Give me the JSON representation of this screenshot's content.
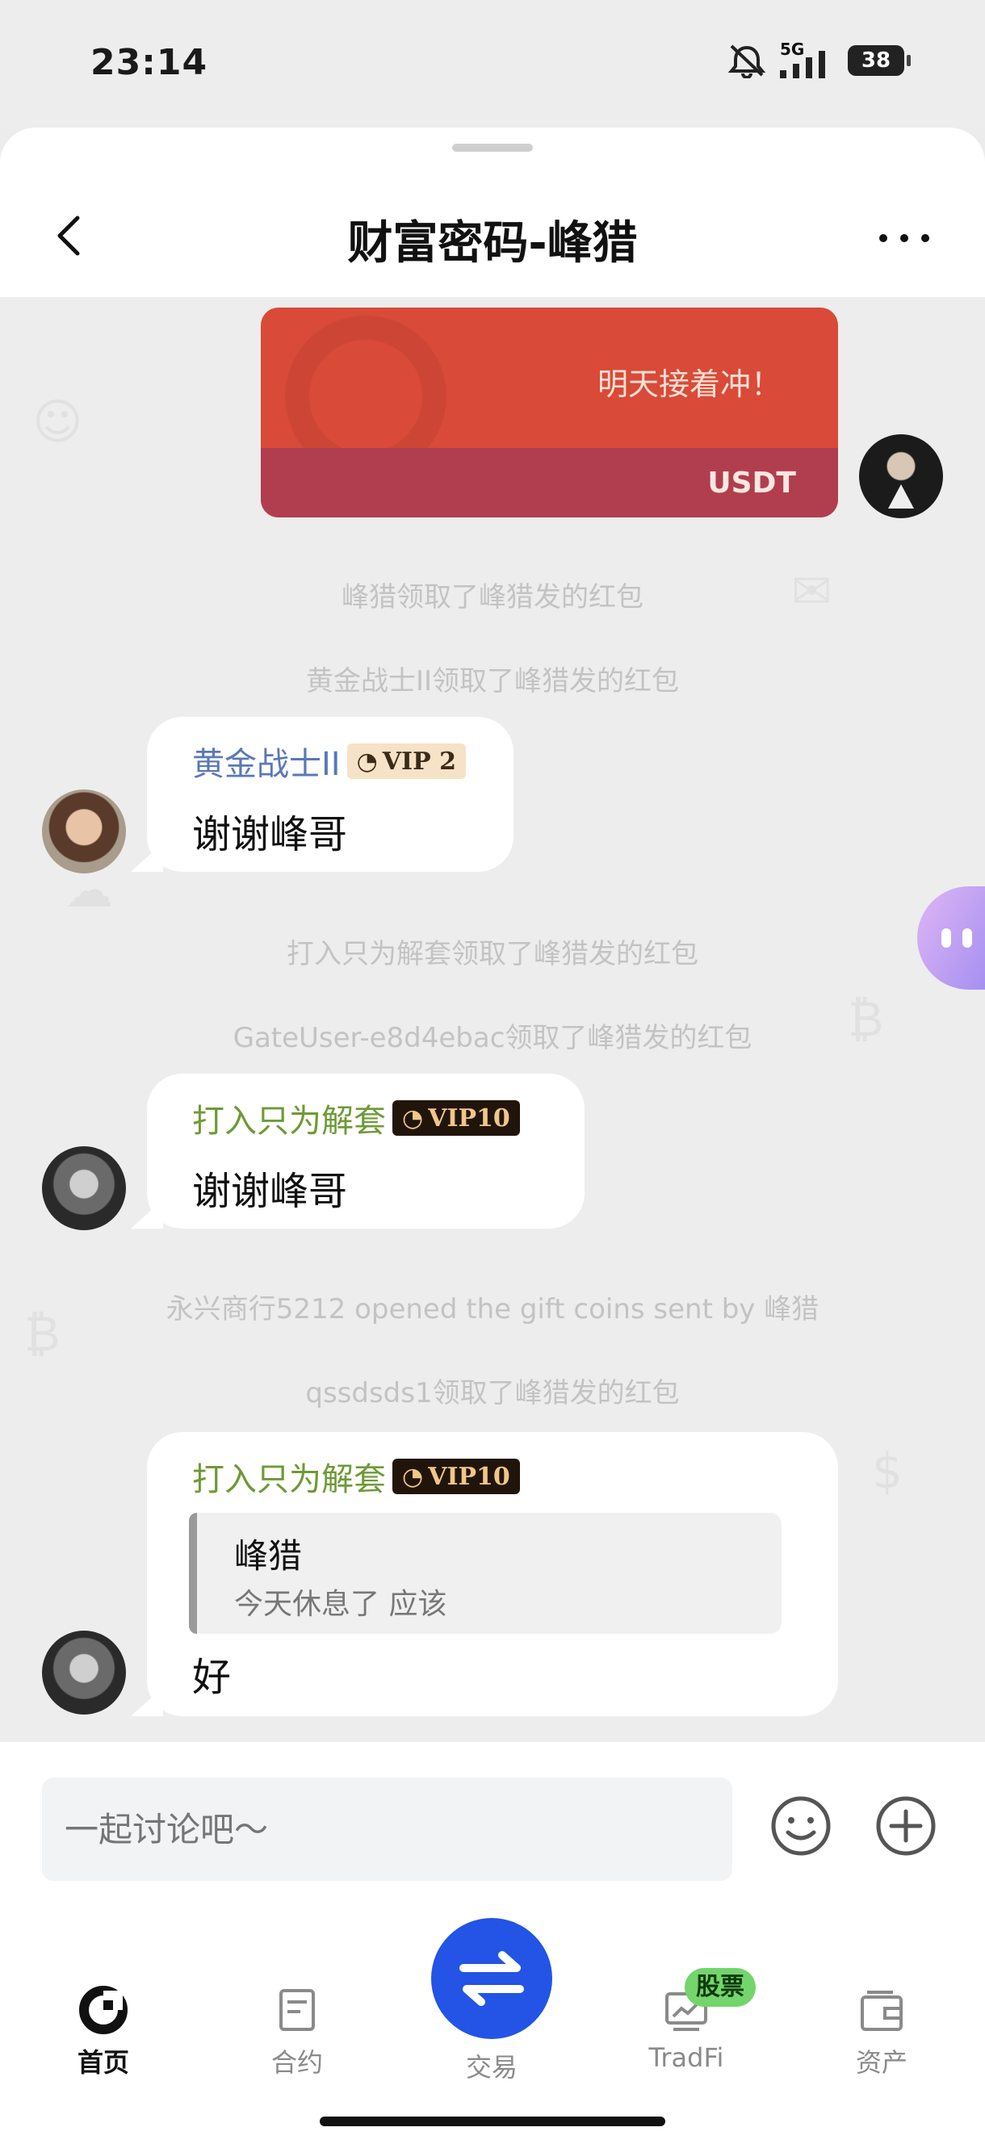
{
  "status_bar": {
    "time": "23:14",
    "network": "5G",
    "battery": "38"
  },
  "header": {
    "title": "财富密码-峰猎"
  },
  "red_packet": {
    "message": "明天接着冲！",
    "currency": "USDT"
  },
  "system_messages": [
    "峰猎领取了峰猎发的红包",
    "黄金战士II领取了峰猎发的红包",
    "打入只为解套领取了峰猎发的红包",
    "GateUser-e8d4ebac领取了峰猎发的红包",
    "永兴商行5212 opened the gift coins sent by 峰猎",
    "qssdsds1领取了峰猎发的红包"
  ],
  "messages": [
    {
      "sender": "黄金战士II",
      "vip": "VIP 2",
      "text": "谢谢峰哥"
    },
    {
      "sender": "打入只为解套",
      "vip": "VIP10",
      "text": "谢谢峰哥"
    },
    {
      "sender": "打入只为解套",
      "vip": "VIP10",
      "quote_name": "峰猎",
      "quote_text": "今天休息了  应该",
      "text": "好"
    }
  ],
  "composer": {
    "placeholder": "一起讨论吧～"
  },
  "tabs": {
    "home": "首页",
    "contract": "合约",
    "trade": "交易",
    "tradfi": "TradFi",
    "assets": "资产",
    "tradfi_badge": "股票"
  },
  "colors": {
    "sender_blue": "#5a78b8",
    "sender_green": "#6e9a36",
    "trade_blue": "#2354e6",
    "red_packet": "#d94a38"
  }
}
